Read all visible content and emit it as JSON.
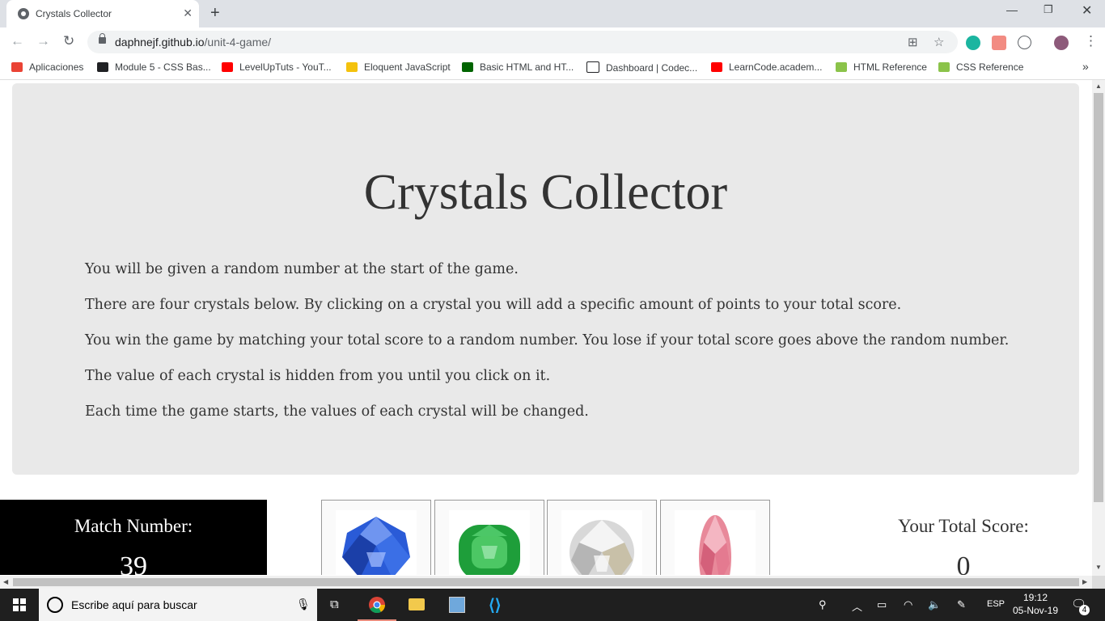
{
  "browser": {
    "tab_title": "Crystals Collector",
    "url_host": "daphnejf.github.io",
    "url_path": "/unit-4-game/",
    "bookmarks": [
      {
        "label": "Aplicaciones",
        "color": "#ea4335"
      },
      {
        "label": "Module 5 - CSS Bas...",
        "color": "#202124"
      },
      {
        "label": "LevelUpTuts - YouT...",
        "color": "#ff0000"
      },
      {
        "label": "Eloquent JavaScript",
        "color": "#f4c20d"
      },
      {
        "label": "Basic HTML and HT...",
        "color": "#006400"
      },
      {
        "label": "Dashboard | Codec...",
        "color": "#202124"
      },
      {
        "label": "LearnCode.academ...",
        "color": "#ff0000"
      },
      {
        "label": "HTML Reference",
        "color": "#8bc34a"
      },
      {
        "label": "CSS Reference",
        "color": "#8bc34a"
      }
    ]
  },
  "page": {
    "title": "Crystals Collector",
    "instructions": [
      "You will be given a random number at the start of the game.",
      "There are four crystals below. By clicking on a crystal you will add a specific amount of points to your total score.",
      "You win the game by matching your total score to a random number. You lose if your total score goes above the random number.",
      "The value of each crystal is hidden from you until you click on it.",
      "Each time the game starts, the values of each crystal will be changed."
    ],
    "match_label": "Match Number:",
    "match_value": "39",
    "score_label": "Your Total Score:",
    "score_value": "0",
    "crystals": [
      {
        "name": "blue-sapphire",
        "color": "#2a5bd7"
      },
      {
        "name": "green-emerald",
        "color": "#1e9e3a"
      },
      {
        "name": "white-diamond",
        "color": "#d8d8d8"
      },
      {
        "name": "pink-diamond",
        "color": "#e8899a"
      }
    ]
  },
  "taskbar": {
    "search_placeholder": "Escribe aquí para buscar",
    "language": "ESP",
    "time": "19:12",
    "date": "05-Nov-19",
    "notification_count": "4"
  }
}
